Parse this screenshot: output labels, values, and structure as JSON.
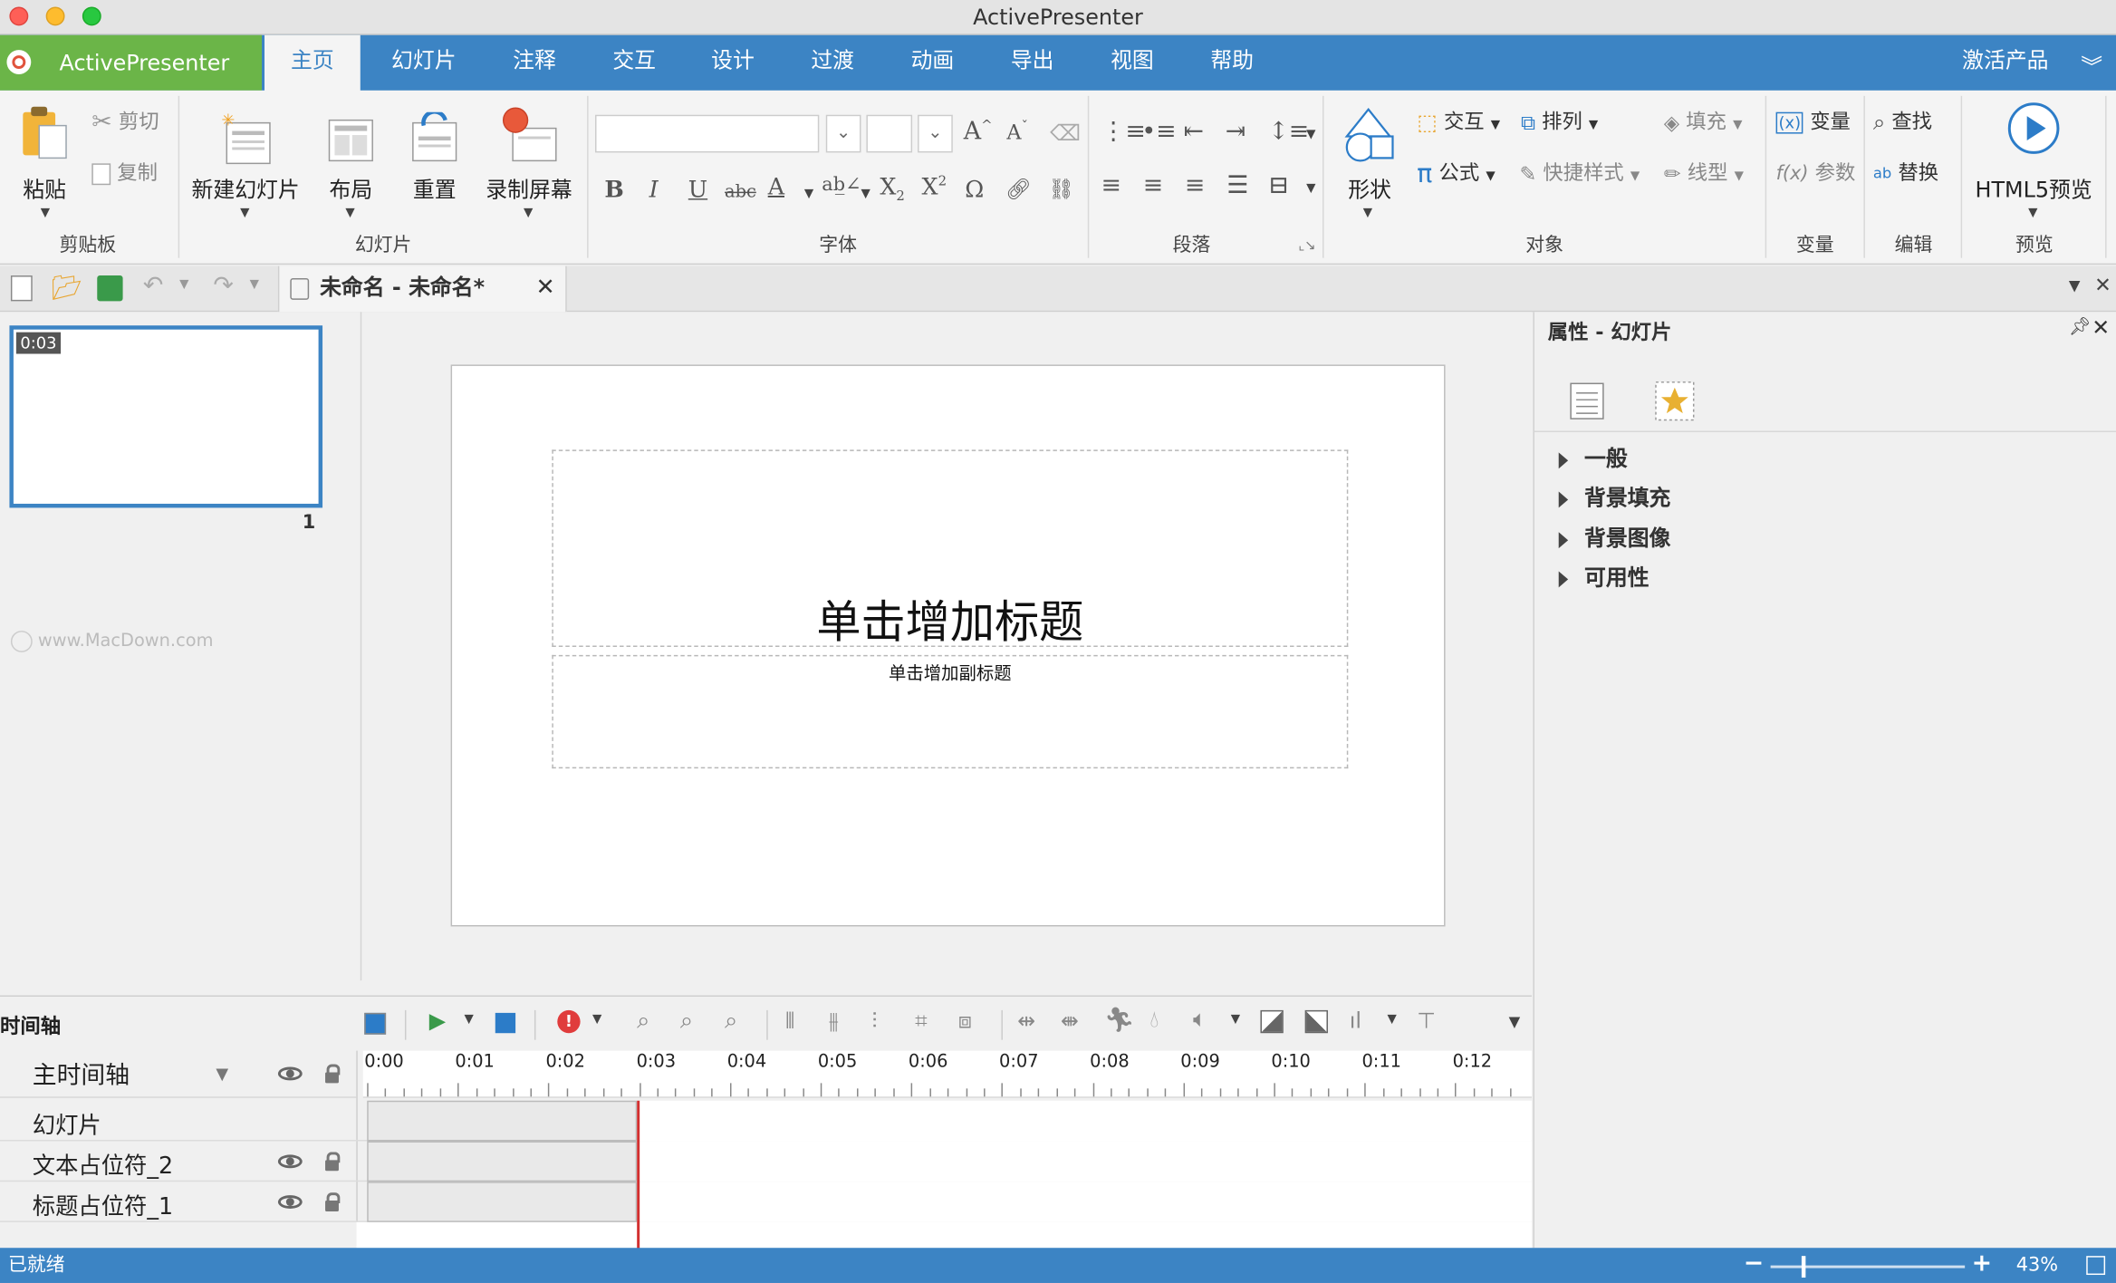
{
  "window": {
    "title": "ActivePresenter"
  },
  "app": {
    "brand": "ActivePresenter"
  },
  "ribbon_tabs": [
    "主页",
    "幻灯片",
    "注释",
    "交互",
    "设计",
    "过渡",
    "动画",
    "导出",
    "视图",
    "帮助"
  ],
  "activate_label": "激活产品",
  "ribbon": {
    "clipboard": {
      "paste": "粘贴",
      "cut": "剪切",
      "copy": "复制",
      "group": "剪贴板"
    },
    "slides": {
      "new_slide": "新建幻灯片",
      "layout": "布局",
      "reset": "重置",
      "record": "录制屏幕",
      "group": "幻灯片"
    },
    "font": {
      "group": "字体",
      "bold": "B",
      "italic": "I",
      "underline": "U",
      "strike": "abc",
      "omega": "Ω"
    },
    "paragraph": {
      "group": "段落"
    },
    "objects": {
      "shape": "形状",
      "interaction": "交互",
      "arrange": "排列",
      "fill": "填充",
      "formula": "公式",
      "quick_style": "快捷样式",
      "line_style": "线型",
      "group": "对象"
    },
    "variables": {
      "variable": "变量",
      "param": "参数",
      "group": "变量"
    },
    "edit": {
      "find": "查找",
      "replace": "替换",
      "group": "编辑"
    },
    "preview": {
      "html5": "HTML5预览",
      "group": "预览"
    }
  },
  "document_tab": {
    "label": "未命名 - 未命名*"
  },
  "slide_panel": {
    "thumb_time": "0:03",
    "thumb_number": "1",
    "watermark": "www.MacDown.com"
  },
  "slide": {
    "title_placeholder": "单击增加标题",
    "subtitle_placeholder": "单击增加副标题"
  },
  "properties": {
    "title": "属性 - 幻灯片",
    "sections": [
      "一般",
      "背景填充",
      "背景图像",
      "可用性"
    ]
  },
  "timeline": {
    "title": "时间轴",
    "main_track": "主时间轴",
    "ticks": [
      "0:00",
      "0:01",
      "0:02",
      "0:03",
      "0:04",
      "0:05",
      "0:06",
      "0:07",
      "0:08",
      "0:09",
      "0:10",
      "0:11",
      "0:12"
    ],
    "rows": [
      "幻灯片",
      "文本占位符_2",
      "标题占位符_1"
    ]
  },
  "status": {
    "text": "已就绪",
    "zoom": "43%"
  },
  "colors": {
    "accent": "#3c84c4",
    "brand_green": "#6bb548"
  }
}
